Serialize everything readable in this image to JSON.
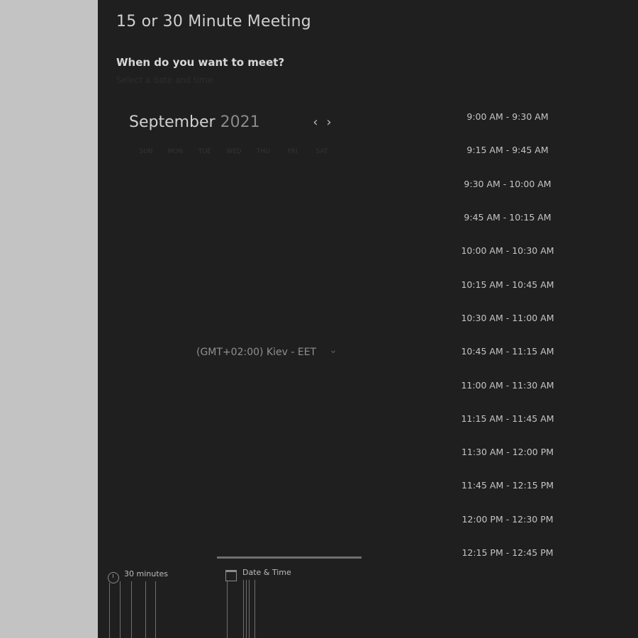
{
  "event": {
    "title": "15 or 30 Minute Meeting",
    "question": "When do you want to meet?",
    "hint": "Select a date and time"
  },
  "calendar": {
    "month": "September",
    "year": "2021",
    "weekdays": [
      "SUN",
      "MON",
      "TUE",
      "WED",
      "THU",
      "FRI",
      "SAT"
    ],
    "prev_icon": "‹",
    "next_icon": "›"
  },
  "timezone": {
    "label": "(GMT+02:00) Kiev - EET",
    "chevron": "⌄"
  },
  "time_slots": [
    "9:00 AM - 9:30 AM",
    "9:15 AM - 9:45 AM",
    "9:30 AM - 10:00 AM",
    "9:45 AM - 10:15 AM",
    "10:00 AM - 10:30 AM",
    "10:15 AM - 10:45 AM",
    "10:30 AM - 11:00 AM",
    "10:45 AM - 11:15 AM",
    "11:00 AM - 11:30 AM",
    "11:15 AM - 11:45 AM",
    "11:30 AM - 12:00 PM",
    "11:45 AM - 12:15 PM",
    "12:00 PM - 12:30 PM",
    "12:15 PM - 12:45 PM"
  ],
  "tabs": {
    "duration": "30 minutes",
    "date_time": "Date & Time"
  },
  "colors": {
    "panel_bg": "#1f1f1f",
    "page_bg": "#c3c3c3"
  }
}
